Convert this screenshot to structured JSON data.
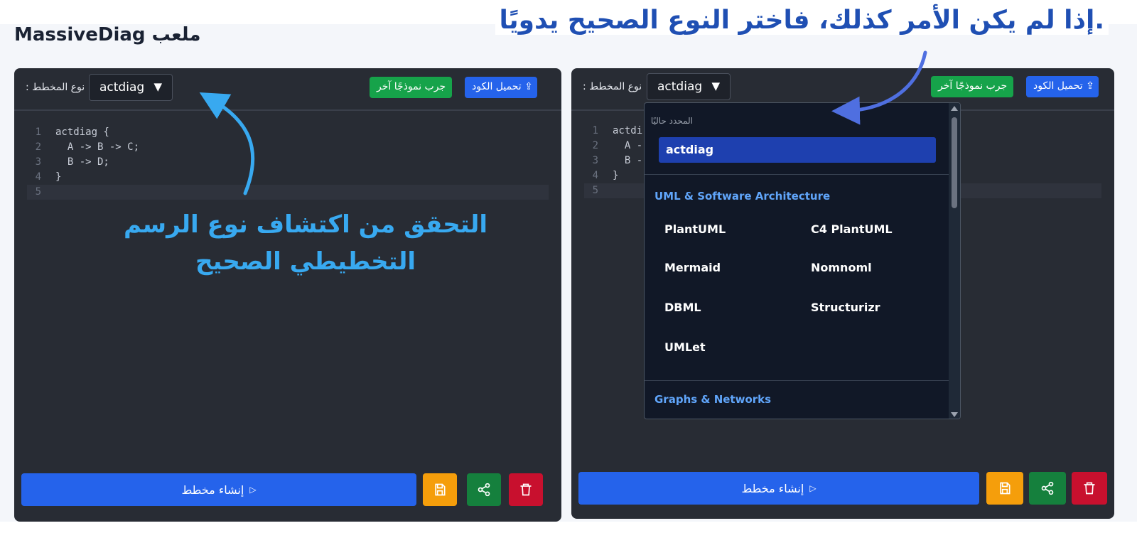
{
  "app": {
    "title": "MassiveDiag ملعب"
  },
  "annotations": {
    "headline": ".إذا لم يكن الأمر كذلك، فاختر النوع الصحيح يدويًا",
    "detect_line1": "التحقق من اكتشاف نوع الرسم",
    "detect_line2": "التخطيطي الصحيح"
  },
  "left_panel": {
    "type_label": ": نوع المخطط",
    "selected_type": "actdiag",
    "upload_label": "تحميل الكود ⇪",
    "sample_label": "جرب نموذجًا آخر",
    "code_lines": [
      {
        "n": "1",
        "text": "actdiag {"
      },
      {
        "n": "2",
        "text": "  A -> B -> C;"
      },
      {
        "n": "3",
        "text": "  B -> D;"
      },
      {
        "n": "4",
        "text": "}"
      },
      {
        "n": "5",
        "text": ""
      }
    ],
    "generate_label": "إنشاء مخطط",
    "generate_icon": "▷"
  },
  "right_panel": {
    "type_label": ": نوع المخطط",
    "selected_type": "actdiag",
    "upload_label": "تحميل الكود ⇪",
    "sample_label": "جرب نموذجًا آخر",
    "code_lines": [
      {
        "n": "1",
        "text": "actdi"
      },
      {
        "n": "2",
        "text": "  A -"
      },
      {
        "n": "3",
        "text": "  B -"
      },
      {
        "n": "4",
        "text": "}"
      },
      {
        "n": "5",
        "text": ""
      }
    ],
    "generate_label": "إنشاء مخطط",
    "generate_icon": "▷"
  },
  "dropdown": {
    "current_label": "المحدد حاليًا",
    "current_value": "actdiag",
    "groups": [
      {
        "name": "UML & Software Architecture",
        "items": [
          "PlantUML",
          "C4 PlantUML",
          "Mermaid",
          "Nomnoml",
          "DBML",
          "Structurizr",
          "UMLet"
        ]
      },
      {
        "name": "Graphs & Networks",
        "items": []
      }
    ]
  },
  "icons": {
    "save": "save-icon",
    "share": "share-icon",
    "delete": "trash-icon",
    "caret": "caret-down-icon",
    "upload": "upload-icon"
  },
  "colors": {
    "accent_blue": "#2563eb",
    "accent_green": "#16a34a",
    "save_yellow": "#f59e0b",
    "delete_red": "#c8102e",
    "annotation_light_blue": "#38a9f0",
    "annotation_dark_blue": "#1f4fb3"
  }
}
